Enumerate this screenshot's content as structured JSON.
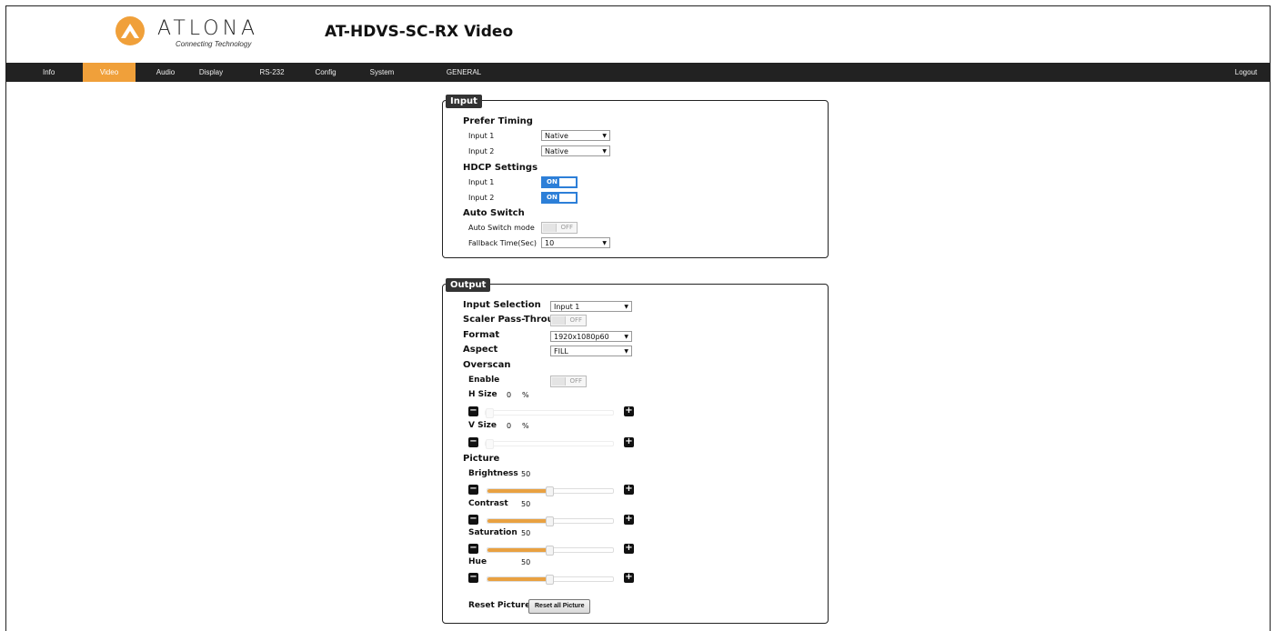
{
  "header": {
    "logo_text": "ATLONA",
    "logo_tagline": "Connecting Technology",
    "page_title": "AT-HDVS-SC-RX  Video",
    "colors": {
      "accent": "#f0a03a",
      "nav_bg": "#222222",
      "toggle_on": "#2d7fd8"
    }
  },
  "nav": {
    "items": [
      "Info",
      "Video",
      "Audio",
      "Display",
      "RS-232",
      "Config",
      "System",
      "GENERAL"
    ],
    "active": "Video",
    "logout": "Logout"
  },
  "input_panel": {
    "legend": "Input",
    "prefer_timing": {
      "heading": "Prefer Timing",
      "input1_label": "Input 1",
      "input1_value": "Native",
      "input2_label": "Input 2",
      "input2_value": "Native"
    },
    "hdcp": {
      "heading": "HDCP Settings",
      "input1_label": "Input 1",
      "input1_state": "ON",
      "input2_label": "Input 2",
      "input2_state": "ON"
    },
    "auto_switch": {
      "heading": "Auto Switch",
      "mode_label": "Auto Switch mode",
      "mode_state": "OFF",
      "fallback_label": "Fallback Time(Sec)",
      "fallback_value": "10"
    }
  },
  "output_panel": {
    "legend": "Output",
    "input_selection_label": "Input Selection",
    "input_selection_value": "Input 1",
    "scaler_label": "Scaler Pass-Through",
    "scaler_state": "OFF",
    "format_label": "Format",
    "format_value": "1920x1080p60",
    "aspect_label": "Aspect",
    "aspect_value": "FILL",
    "overscan": {
      "heading": "Overscan",
      "enable_label": "Enable",
      "enable_state": "OFF",
      "h_size_label": "H Size",
      "h_size_value": "0",
      "v_size_label": "V Size",
      "v_size_value": "0",
      "unit": "%"
    },
    "picture": {
      "heading": "Picture",
      "brightness_label": "Brightness",
      "brightness_value": "50",
      "contrast_label": "Contrast",
      "contrast_value": "50",
      "saturation_label": "Saturation",
      "saturation_value": "50",
      "hue_label": "Hue",
      "hue_value": "50"
    },
    "reset_label": "Reset Pictures",
    "reset_button": "Reset all Picture"
  }
}
